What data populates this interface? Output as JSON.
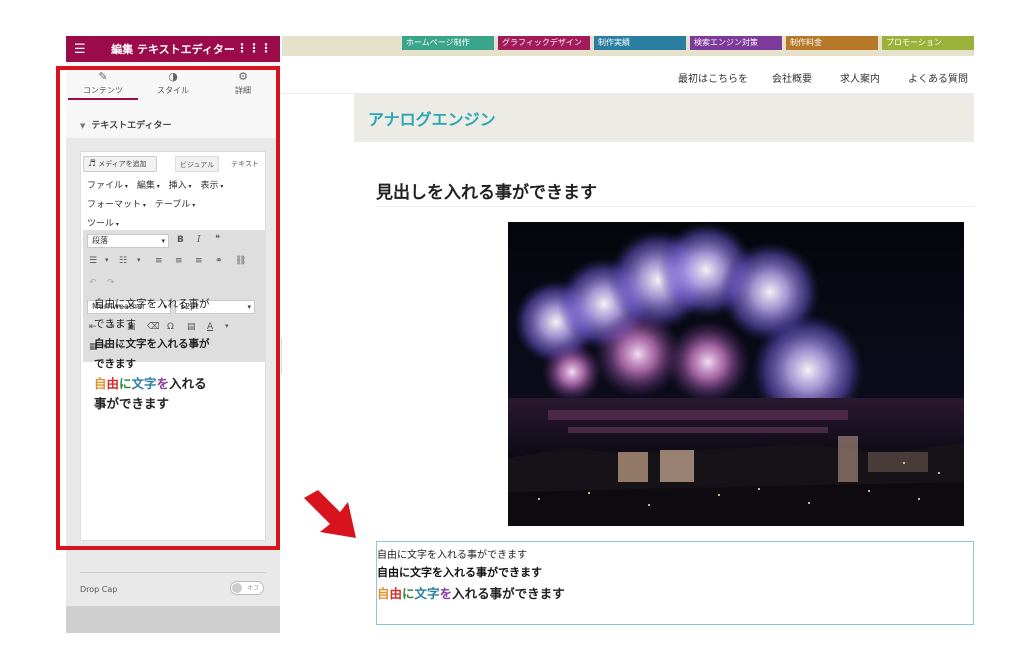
{
  "panel": {
    "header_title": "編集 テキストエディター",
    "tabs": [
      {
        "label": "コンテンツ",
        "icon": "pencil-icon"
      },
      {
        "label": "スタイル",
        "icon": "half-circle-icon"
      },
      {
        "label": "詳細",
        "icon": "gear-icon"
      }
    ],
    "section_title": "テキストエディター",
    "media_button": "メディアを追加",
    "mode_tabs": {
      "visual": "ビジュアル",
      "text": "テキスト"
    },
    "menu_row1": [
      "ファイル",
      "編集",
      "挿入",
      "表示"
    ],
    "menu_row2": [
      "フォーマット",
      "テーブル"
    ],
    "menu_row3": [
      "ツール"
    ],
    "format_select": "段落",
    "font_select": "Merriweather",
    "size_select": "12pt",
    "editor_lines": [
      "自由に文字を入れる事が",
      "できます",
      "自由に文字を入れる事が",
      "できます",
      "自由に文字を入れる",
      "事ができます"
    ],
    "dropcap_label": "Drop Cap",
    "dropcap_toggle": "オフ"
  },
  "site": {
    "categories": [
      {
        "label": "ホームページ制作",
        "color": "#3aa58a"
      },
      {
        "label": "グラフィックデザイン",
        "color": "#a31a5b"
      },
      {
        "label": "制作実績",
        "color": "#2a7ea1"
      },
      {
        "label": "検索エンジン対策",
        "color": "#7e3a9a"
      },
      {
        "label": "制作料金",
        "color": "#b8782a"
      },
      {
        "label": "プロモーション",
        "color": "#9bb23a"
      }
    ],
    "nav": [
      "最初はこちらを",
      "会社概要",
      "求人案内",
      "よくある質問"
    ],
    "title": "アナログエンジン",
    "heading": "見出しを入れる事ができます",
    "lines": [
      "自由に文字を入れる事ができます",
      "自由に文字を入れる事ができます",
      "自由に文字を入れる事ができます"
    ]
  },
  "colors": {
    "accent": "#9b0a49",
    "highlight_frame": "#d7141e",
    "site_title": "#2aa7b3"
  }
}
